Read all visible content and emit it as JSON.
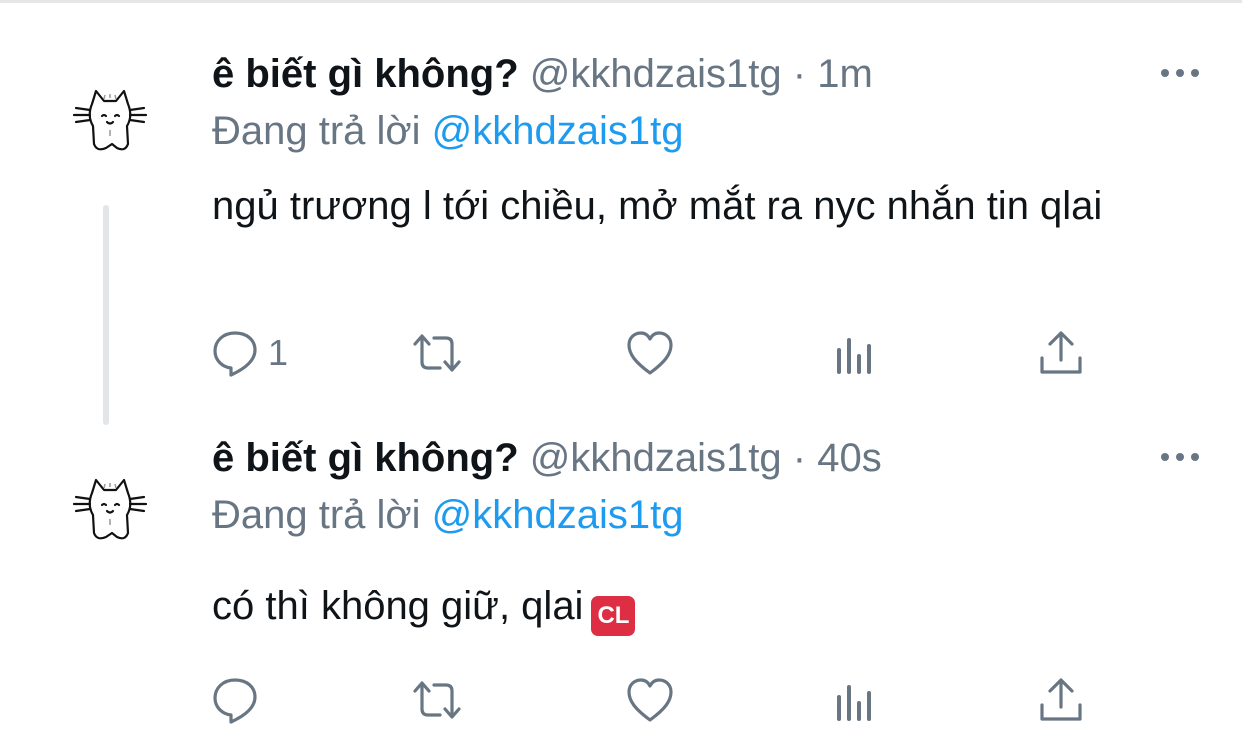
{
  "tweets": [
    {
      "display_name": "ê biết gì không?",
      "handle": "@kkhdzais1tg",
      "separator": "·",
      "time": "1m",
      "replying_prefix": "Đang trả lời",
      "replying_to": "@kkhdzais1tg",
      "text": "ngủ trương l tới chiều, mở mắt ra nyc nhắn tin qlai",
      "reply_count": "1"
    },
    {
      "display_name": "ê biết gì không?",
      "handle": "@kkhdzais1tg",
      "separator": "·",
      "time": "40s",
      "replying_prefix": "Đang trả lời",
      "replying_to": "@kkhdzais1tg",
      "text": "có thì không giữ, qlai",
      "emoji_label": "CL",
      "reply_count": ""
    }
  ],
  "icons": [
    "avatar",
    "more-icon",
    "reply-icon",
    "retweet-icon",
    "like-icon",
    "stats-icon",
    "share-icon"
  ],
  "colors": {
    "text": "#0f1419",
    "secondary": "#687684",
    "link": "#1d9bf0",
    "thread_line": "#e2e6e9",
    "emoji_bg": "#dd2e44"
  }
}
